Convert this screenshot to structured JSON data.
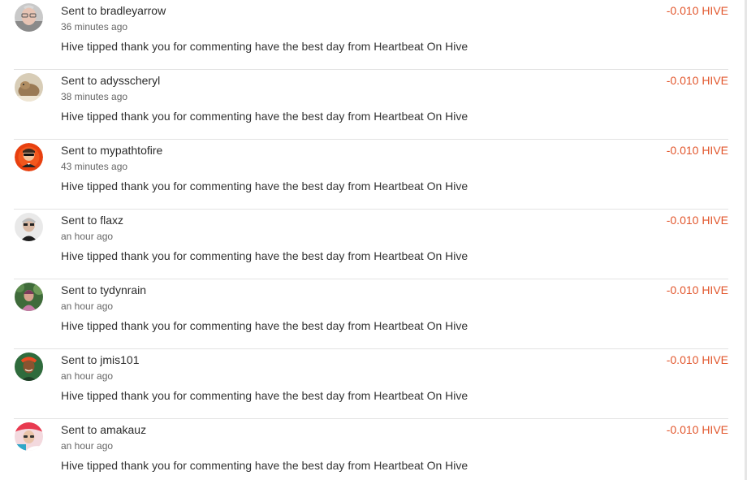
{
  "theme": {
    "amount_color": "#e2562c"
  },
  "transfers": [
    {
      "prefix": "Sent to",
      "user": "bradleyarrow",
      "time": "36 minutes ago",
      "memo": "Hive tipped thank you for commenting have the best day from Heartbeat On Hive",
      "amount": "-0.010 HIVE",
      "avatar_icon": "bradleyarrow-avatar-icon"
    },
    {
      "prefix": "Sent to",
      "user": "adysscheryl",
      "time": "38 minutes ago",
      "memo": "Hive tipped thank you for commenting have the best day from Heartbeat On Hive",
      "amount": "-0.010 HIVE",
      "avatar_icon": "adysscheryl-avatar-icon"
    },
    {
      "prefix": "Sent to",
      "user": "mypathtofire",
      "time": "43 minutes ago",
      "memo": "Hive tipped thank you for commenting have the best day from Heartbeat On Hive",
      "amount": "-0.010 HIVE",
      "avatar_icon": "mypathtofire-avatar-icon"
    },
    {
      "prefix": "Sent to",
      "user": "flaxz",
      "time": "an hour ago",
      "memo": "Hive tipped thank you for commenting have the best day from Heartbeat On Hive",
      "amount": "-0.010 HIVE",
      "avatar_icon": "flaxz-avatar-icon"
    },
    {
      "prefix": "Sent to",
      "user": "tydynrain",
      "time": "an hour ago",
      "memo": "Hive tipped thank you for commenting have the best day from Heartbeat On Hive",
      "amount": "-0.010 HIVE",
      "avatar_icon": "tydynrain-avatar-icon"
    },
    {
      "prefix": "Sent to",
      "user": "jmis101",
      "time": "an hour ago",
      "memo": "Hive tipped thank you for commenting have the best day from Heartbeat On Hive",
      "amount": "-0.010 HIVE",
      "avatar_icon": "jmis101-avatar-icon"
    },
    {
      "prefix": "Sent to",
      "user": "amakauz",
      "time": "an hour ago",
      "memo": "Hive tipped thank you for commenting have the best day from Heartbeat On Hive",
      "amount": "-0.010 HIVE",
      "avatar_icon": "amakauz-avatar-icon"
    }
  ]
}
